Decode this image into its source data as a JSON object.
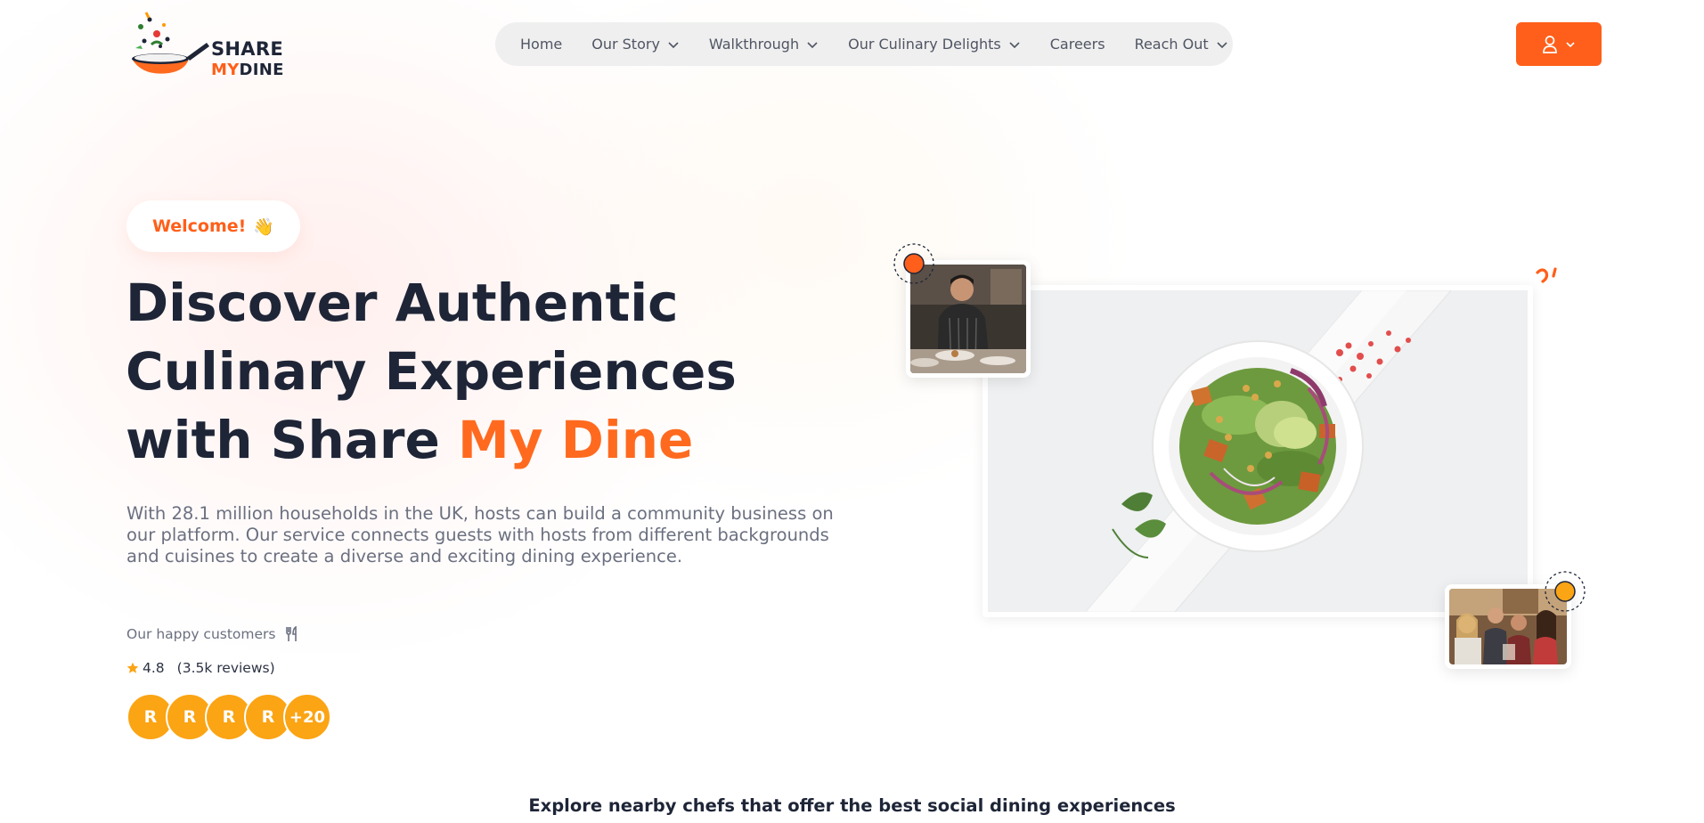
{
  "brand": {
    "line1": "SHARE",
    "line2_accent": "MY",
    "line2_rest": "DINE"
  },
  "nav": {
    "items": [
      {
        "label": "Home",
        "dropdown": false
      },
      {
        "label": "Our Story",
        "dropdown": true
      },
      {
        "label": "Walkthrough",
        "dropdown": true
      },
      {
        "label": "Our Culinary Delights",
        "dropdown": true
      },
      {
        "label": "Careers",
        "dropdown": false
      },
      {
        "label": "Reach Out",
        "dropdown": true
      }
    ]
  },
  "user_menu": {
    "icon": "user-icon"
  },
  "hero": {
    "welcome": "Welcome!",
    "welcome_emoji": "👋",
    "title_line1": "Discover Authentic",
    "title_line2": "Culinary Experiences",
    "title_line3_plain": "with Share ",
    "title_line3_accent": "My Dine",
    "description": "With 28.1 million households in the UK, hosts can build a community business on our platform. Our service connects guests with hosts from different backgrounds and cuisines to create a diverse and exciting dining experience.",
    "happy_label": "Our happy customers",
    "rating_value": "4.8",
    "rating_reviews": "(3.5k reviews)",
    "avatars": [
      "R",
      "R",
      "R",
      "R",
      "+20"
    ]
  },
  "explore_heading": "Explore nearby chefs that offer the best social dining experiences",
  "colors": {
    "accent": "#ff5f1a",
    "navy": "#1e2537",
    "avatar": "#fba414",
    "nav_bg": "#efefef"
  }
}
